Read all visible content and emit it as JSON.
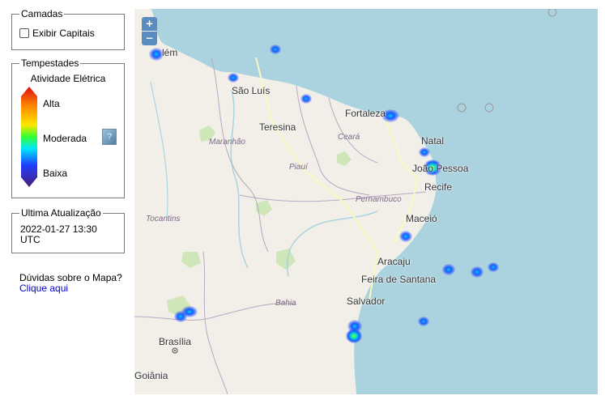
{
  "layers": {
    "title": "Camadas",
    "checkbox_label": "Exibir Capitais",
    "checked": false
  },
  "storms": {
    "title": "Tempestades",
    "subtitle": "Atividade Elétrica",
    "levels": {
      "high": "Alta",
      "moderate": "Moderada",
      "low": "Baixa"
    },
    "info_icon": "info-icon"
  },
  "update": {
    "title": "Ultima Atualização",
    "timestamp": "2022-01-27 13:30 UTC"
  },
  "help": {
    "question": "Dúvidas sobre o Mapa?",
    "link_label": "Clique aqui"
  },
  "map": {
    "zoom_in": "+",
    "zoom_out": "−",
    "cities": {
      "belem": "lém",
      "sao_luis": "São Luís",
      "teresina": "Teresina",
      "fortaleza": "Fortaleza",
      "natal": "Natal",
      "joao_pessoa": "João Pessoa",
      "recife": "Recife",
      "maceio": "Maceió",
      "aracaju": "Aracaju",
      "feira": "Feira de Santana",
      "salvador": "Salvador",
      "brasilia": "Brasília",
      "goiania": "Goiânia"
    },
    "states": {
      "maranhao": "Maranhão",
      "ceara": "Ceará",
      "piaui": "Piauí",
      "pernambuco": "Pernambuco",
      "tocantins": "Tocantins",
      "bahia": "Bahia"
    }
  },
  "colors": {
    "ocean": "#aad3df",
    "land": "#f2efe9",
    "low_activity": "#1a3cff",
    "moderate_activity": "#33ff66",
    "high_activity": "#ff2a00",
    "zoom_button": "#5b8cc0",
    "link": "#0000cc"
  }
}
